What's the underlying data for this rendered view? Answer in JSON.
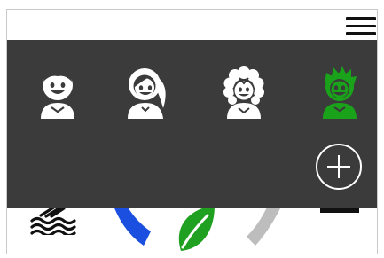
{
  "header": {
    "menu_icon": "hamburger-menu-icon"
  },
  "profiles": [
    {
      "icon": "boy-avatar-icon",
      "color": "#ffffff",
      "selected": false
    },
    {
      "icon": "girl-ponytail-avatar-icon",
      "color": "#ffffff",
      "selected": false
    },
    {
      "icon": "girl-curly-avatar-icon",
      "color": "#ffffff",
      "selected": false
    },
    {
      "icon": "boy-spiky-avatar-icon",
      "color": "#1aa31a",
      "selected": true
    }
  ],
  "add_profile": {
    "icon": "plus-circle-icon"
  },
  "modes": [
    {
      "icon": "water-waves-icon",
      "color": "#111111"
    },
    {
      "icon": "blue-band-icon",
      "color": "#1a4fe0"
    },
    {
      "icon": "leaf-icon",
      "color": "#20a020"
    },
    {
      "icon": "gray-band-icon",
      "color": "#bdbdbd"
    },
    {
      "icon": "black-bar-icon",
      "color": "#111111"
    }
  ],
  "colors": {
    "overlay": "#3b3b3b",
    "accent": "#1aa31a"
  }
}
